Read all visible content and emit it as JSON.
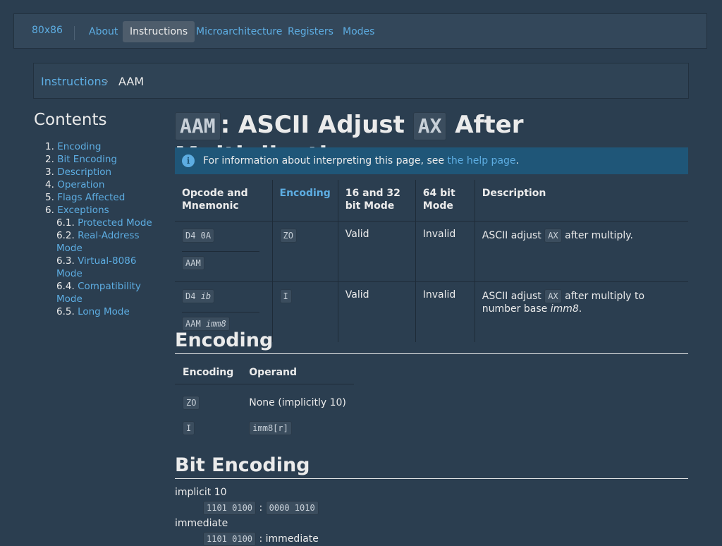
{
  "nav": {
    "brand": "80x86",
    "items": [
      {
        "label": "About"
      },
      {
        "label": "Instructions"
      },
      {
        "label": "Microarchitecture"
      },
      {
        "label": "Registers"
      },
      {
        "label": "Modes"
      }
    ]
  },
  "breadcrumb": {
    "parent": "Instructions",
    "current": "AAM"
  },
  "toc": {
    "title": "Contents",
    "items": [
      {
        "num": "1.",
        "label": "Encoding"
      },
      {
        "num": "2.",
        "label": "Bit Encoding"
      },
      {
        "num": "3.",
        "label": "Description"
      },
      {
        "num": "4.",
        "label": "Operation"
      },
      {
        "num": "5.",
        "label": "Flags Affected"
      },
      {
        "num": "6.",
        "label": "Exceptions"
      },
      {
        "num": "6.1.",
        "label": "Protected Mode"
      },
      {
        "num": "6.2.",
        "label": "Real-Address Mode"
      },
      {
        "num": "6.3.",
        "label": "Virtual-8086 Mode"
      },
      {
        "num": "6.4.",
        "label": "Compatibility Mode"
      },
      {
        "num": "6.5.",
        "label": "Long Mode"
      }
    ]
  },
  "title": {
    "code1": "AAM",
    "part1": ": ASCII Adjust ",
    "code2": "AX",
    "part2": " After Multiplication"
  },
  "info": {
    "prefix": "For information about interpreting this page, see ",
    "link": "the help page",
    "suffix": "."
  },
  "opcode_table": {
    "headers": [
      "Opcode and Mnemonic",
      "Encoding",
      "16 and 32 bit Mode",
      "64 bit Mode",
      "Description"
    ],
    "rows": [
      {
        "opcode": "D4 0A",
        "mnemonic": "AAM",
        "encoding": "ZO",
        "mode32": "Valid",
        "mode64": "Invalid",
        "desc_pre": "ASCII adjust ",
        "desc_code": "AX",
        "desc_post": " after multiply.",
        "desc_italic": ""
      },
      {
        "opcode_a": "D4 ",
        "opcode_b": "ib",
        "mnemonic_a": "AAM ",
        "mnemonic_b": "imm8",
        "encoding": "I",
        "mode32": "Valid",
        "mode64": "Invalid",
        "desc_pre": "ASCII adjust ",
        "desc_code": "AX",
        "desc_post": " after multiply to number base ",
        "desc_italic": "imm8",
        "desc_end": "."
      }
    ]
  },
  "encoding": {
    "heading": "Encoding",
    "headers": [
      "Encoding",
      "Operand"
    ],
    "rows": [
      {
        "encoding": "ZO",
        "operand": "None (implicitly 10)"
      },
      {
        "encoding": "I",
        "operand": "imm8[r]"
      }
    ]
  },
  "bit_encoding": {
    "heading": "Bit Encoding",
    "items": [
      {
        "label": "implicit 10",
        "part1": "1101 0100",
        "sep": " : ",
        "part2": "0000 1010"
      },
      {
        "label": "immediate",
        "part1": "1101 0100",
        "sep": " : ",
        "part2": "immediate"
      }
    ]
  }
}
